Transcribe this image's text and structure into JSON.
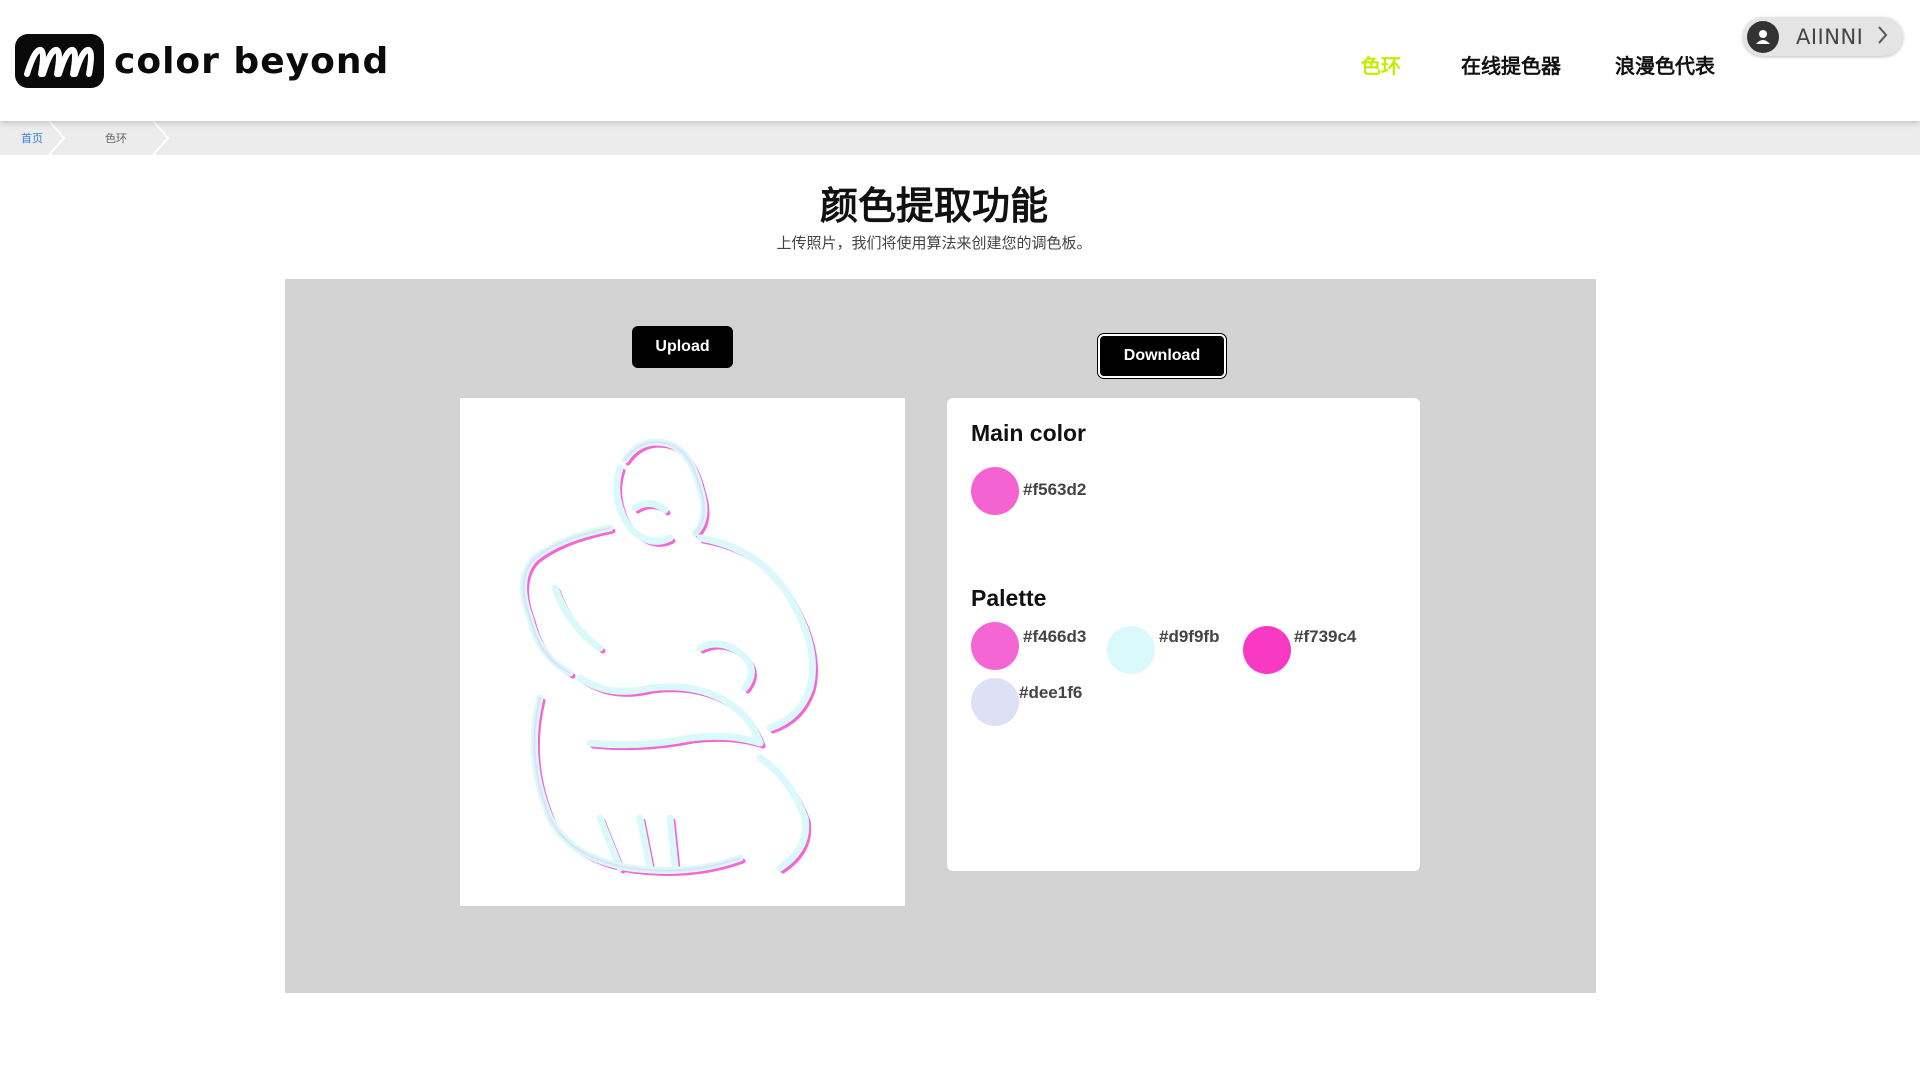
{
  "header": {
    "brand": "color beyond",
    "nav": [
      {
        "label": "色环",
        "active": true
      },
      {
        "label": "在线提色器",
        "active": false
      },
      {
        "label": "浪漫色代表",
        "active": false
      }
    ],
    "user": {
      "name": "AIINNI"
    }
  },
  "breadcrumb": {
    "home": "首页",
    "current": "色环"
  },
  "page": {
    "title": "颜色提取功能",
    "subtitle": "上传照片，我们将使用算法来创建您的调色板。"
  },
  "actions": {
    "upload_label": "Upload",
    "download_label": "Download"
  },
  "results": {
    "main_heading": "Main color",
    "main_color": {
      "hex": "#f563d2",
      "color": "#f563d2"
    },
    "palette_heading": "Palette",
    "palette": [
      {
        "hex": "#f466d3",
        "color": "#f466d3"
      },
      {
        "hex": "#d9f9fb",
        "color": "#d9f9fb"
      },
      {
        "hex": "#f739c4",
        "color": "#f739c4"
      },
      {
        "hex": "#dee1f6",
        "color": "#dee1f6"
      }
    ]
  },
  "colors": {
    "nav_active": "#c5ec00",
    "panel_bg": "#d3d3d3",
    "breadcrumb_link": "#2f7fd6"
  }
}
